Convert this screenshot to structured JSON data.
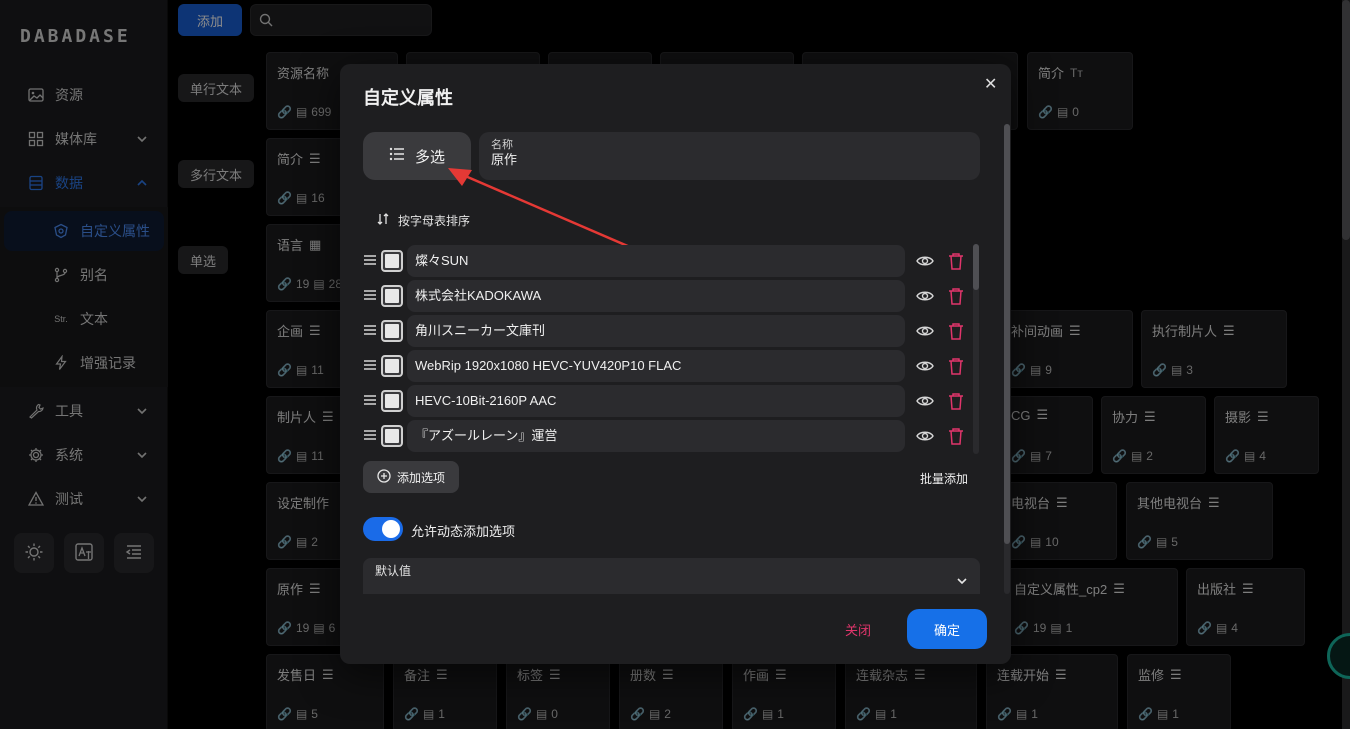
{
  "app": {
    "logo": "DABADASE"
  },
  "sidebar": {
    "items": [
      {
        "label": "资源",
        "icon": "image-icon"
      },
      {
        "label": "媒体库",
        "icon": "grid-icon"
      },
      {
        "label": "数据",
        "icon": "database-icon"
      },
      {
        "label": "自定义属性",
        "icon": "shield-icon"
      },
      {
        "label": "别名",
        "icon": "branch-icon"
      },
      {
        "label": "文本",
        "icon": "str-icon"
      },
      {
        "label": "增强记录",
        "icon": "bolt-icon"
      },
      {
        "label": "工具",
        "icon": "wrench-icon"
      },
      {
        "label": "系统",
        "icon": "gear-icon"
      },
      {
        "label": "测试",
        "icon": "warning-icon"
      }
    ],
    "str_glyph": "Str."
  },
  "toolbar": {
    "add_label": "添加",
    "search_placeholder": ""
  },
  "categories": [
    "单行文本",
    "多行文本",
    "单选"
  ],
  "cards": [
    {
      "title": "资源名称",
      "count": "699"
    },
    {
      "title": "简介",
      "count": "0"
    },
    {
      "title": "简介",
      "count": "16"
    },
    {
      "title": "语言",
      "count": "19",
      "count2": "28"
    },
    {
      "title": "企画",
      "count": "11"
    },
    {
      "title": "补间动画",
      "count": "9"
    },
    {
      "title": "执行制片人",
      "count": "3"
    },
    {
      "title": "制片人",
      "count": "11"
    },
    {
      "title": "CG",
      "count": "7"
    },
    {
      "title": "协力",
      "count": "2"
    },
    {
      "title": "摄影",
      "count": "4"
    },
    {
      "title": "设定制作",
      "count": "2"
    },
    {
      "title": "电视台",
      "count": "10"
    },
    {
      "title": "其他电视台",
      "count": "5"
    },
    {
      "title": "原作",
      "count": "19",
      "count2": "6"
    },
    {
      "title": "自定义属性_cp2",
      "count": "19",
      "count2": "1"
    },
    {
      "title": "出版社",
      "count": "4"
    },
    {
      "title": "发售日",
      "count": "5"
    },
    {
      "title": "备注",
      "count": "1"
    },
    {
      "title": "标签",
      "count": "0"
    },
    {
      "title": "册数",
      "count": "2"
    },
    {
      "title": "作画",
      "count": "1"
    },
    {
      "title": "连载杂志",
      "count": "1"
    },
    {
      "title": "连载开始",
      "count": "1"
    },
    {
      "title": "监修",
      "count": "1"
    }
  ],
  "modal": {
    "title": "自定义属性",
    "type_label": "多选",
    "name_label": "名称",
    "name_value": "原作",
    "sort_label": "按字母表排序",
    "options": [
      "燦々SUN",
      "株式会社KADOKAWA",
      "角川スニーカー文庫刊",
      "WebRip 1920x1080 HEVC-YUV420P10 FLAC",
      "HEVC-10Bit-2160P AAC",
      "『アズールレーン』運営"
    ],
    "add_option_label": "添加选项",
    "bulk_add_label": "批量添加",
    "allow_dynamic_label": "允许动态添加选项",
    "allow_dynamic": true,
    "default_value_label": "默认值",
    "close_label": "关闭",
    "confirm_label": "确定"
  },
  "colors": {
    "accent": "#1670e8",
    "danger": "#e0356b",
    "annotation_arrow": "#e53935"
  }
}
